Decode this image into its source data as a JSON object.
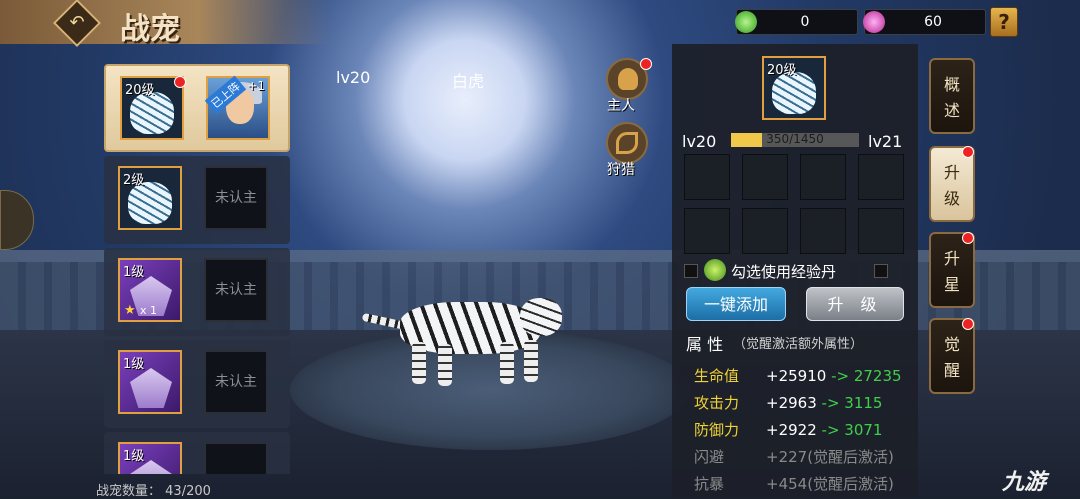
{
  "header": {
    "title": "战宠",
    "back_icon": "back-arrow-icon",
    "resource_1": {
      "icon": "green-gem-icon",
      "value": "0",
      "color": "#4fd03a"
    },
    "resource_2": {
      "icon": "purple-gem-icon",
      "value": "60",
      "color": "#d04ac8"
    },
    "help_label": "?"
  },
  "pet_list": {
    "items": [
      {
        "level": "20级",
        "type": "white-tiger",
        "owner": "hero",
        "hero_tag": "已上阵",
        "hero_plus": "+1",
        "selected": true,
        "red_dot": true
      },
      {
        "level": "2级",
        "type": "white-tiger",
        "owner_label": "未认主",
        "selected": false,
        "red_dot": false
      },
      {
        "level": "1级",
        "type": "purple-dragon",
        "stars": "1",
        "star_mult": "x 1",
        "owner_label": "未认主",
        "selected": false,
        "red_dot": false
      },
      {
        "level": "1级",
        "type": "purple-dragon",
        "owner_label": "未认主",
        "selected": false,
        "red_dot": false
      },
      {
        "level": "1级",
        "type": "purple-dragon",
        "owner_label": "",
        "selected": false,
        "red_dot": false
      }
    ],
    "count_label": "战宠数量：",
    "count_value": "43/200"
  },
  "pet_display": {
    "level": "lv20",
    "name": "白虎",
    "btn_owner": "主人",
    "btn_hunt": "狩猎"
  },
  "upgrade_panel": {
    "pet_level": "20级",
    "cur_level": "lv20",
    "next_level": "lv21",
    "xp_text": "350/1450",
    "xp_fraction": 0.2414,
    "use_exp_label": "勾选使用经验丹",
    "btn_auto_add": "一键添加",
    "btn_upgrade": "升 级",
    "attr_title": "属 性",
    "attr_subtitle": "（觉醒激活额外属性）",
    "attributes": [
      {
        "name": "生命值",
        "value": "+25910",
        "arrow": "-> 27235",
        "dim": false
      },
      {
        "name": "攻击力",
        "value": "+2963",
        "arrow": "-> 3115",
        "dim": false
      },
      {
        "name": "防御力",
        "value": "+2922",
        "arrow": "-> 3071",
        "dim": false
      },
      {
        "name": "闪避",
        "value": "+227(觉醒后激活)",
        "arrow": "",
        "dim": true
      },
      {
        "name": "抗暴",
        "value": "+454(觉醒后激活)",
        "arrow": "",
        "dim": true
      }
    ]
  },
  "right_tabs": [
    {
      "label": "概\n述",
      "active": false,
      "red_dot": false
    },
    {
      "label": "升\n级",
      "active": true,
      "red_dot": true
    },
    {
      "label": "升\n星",
      "active": false,
      "red_dot": true
    },
    {
      "label": "觉\n醒",
      "active": false,
      "red_dot": true
    }
  ],
  "watermark": "九游"
}
